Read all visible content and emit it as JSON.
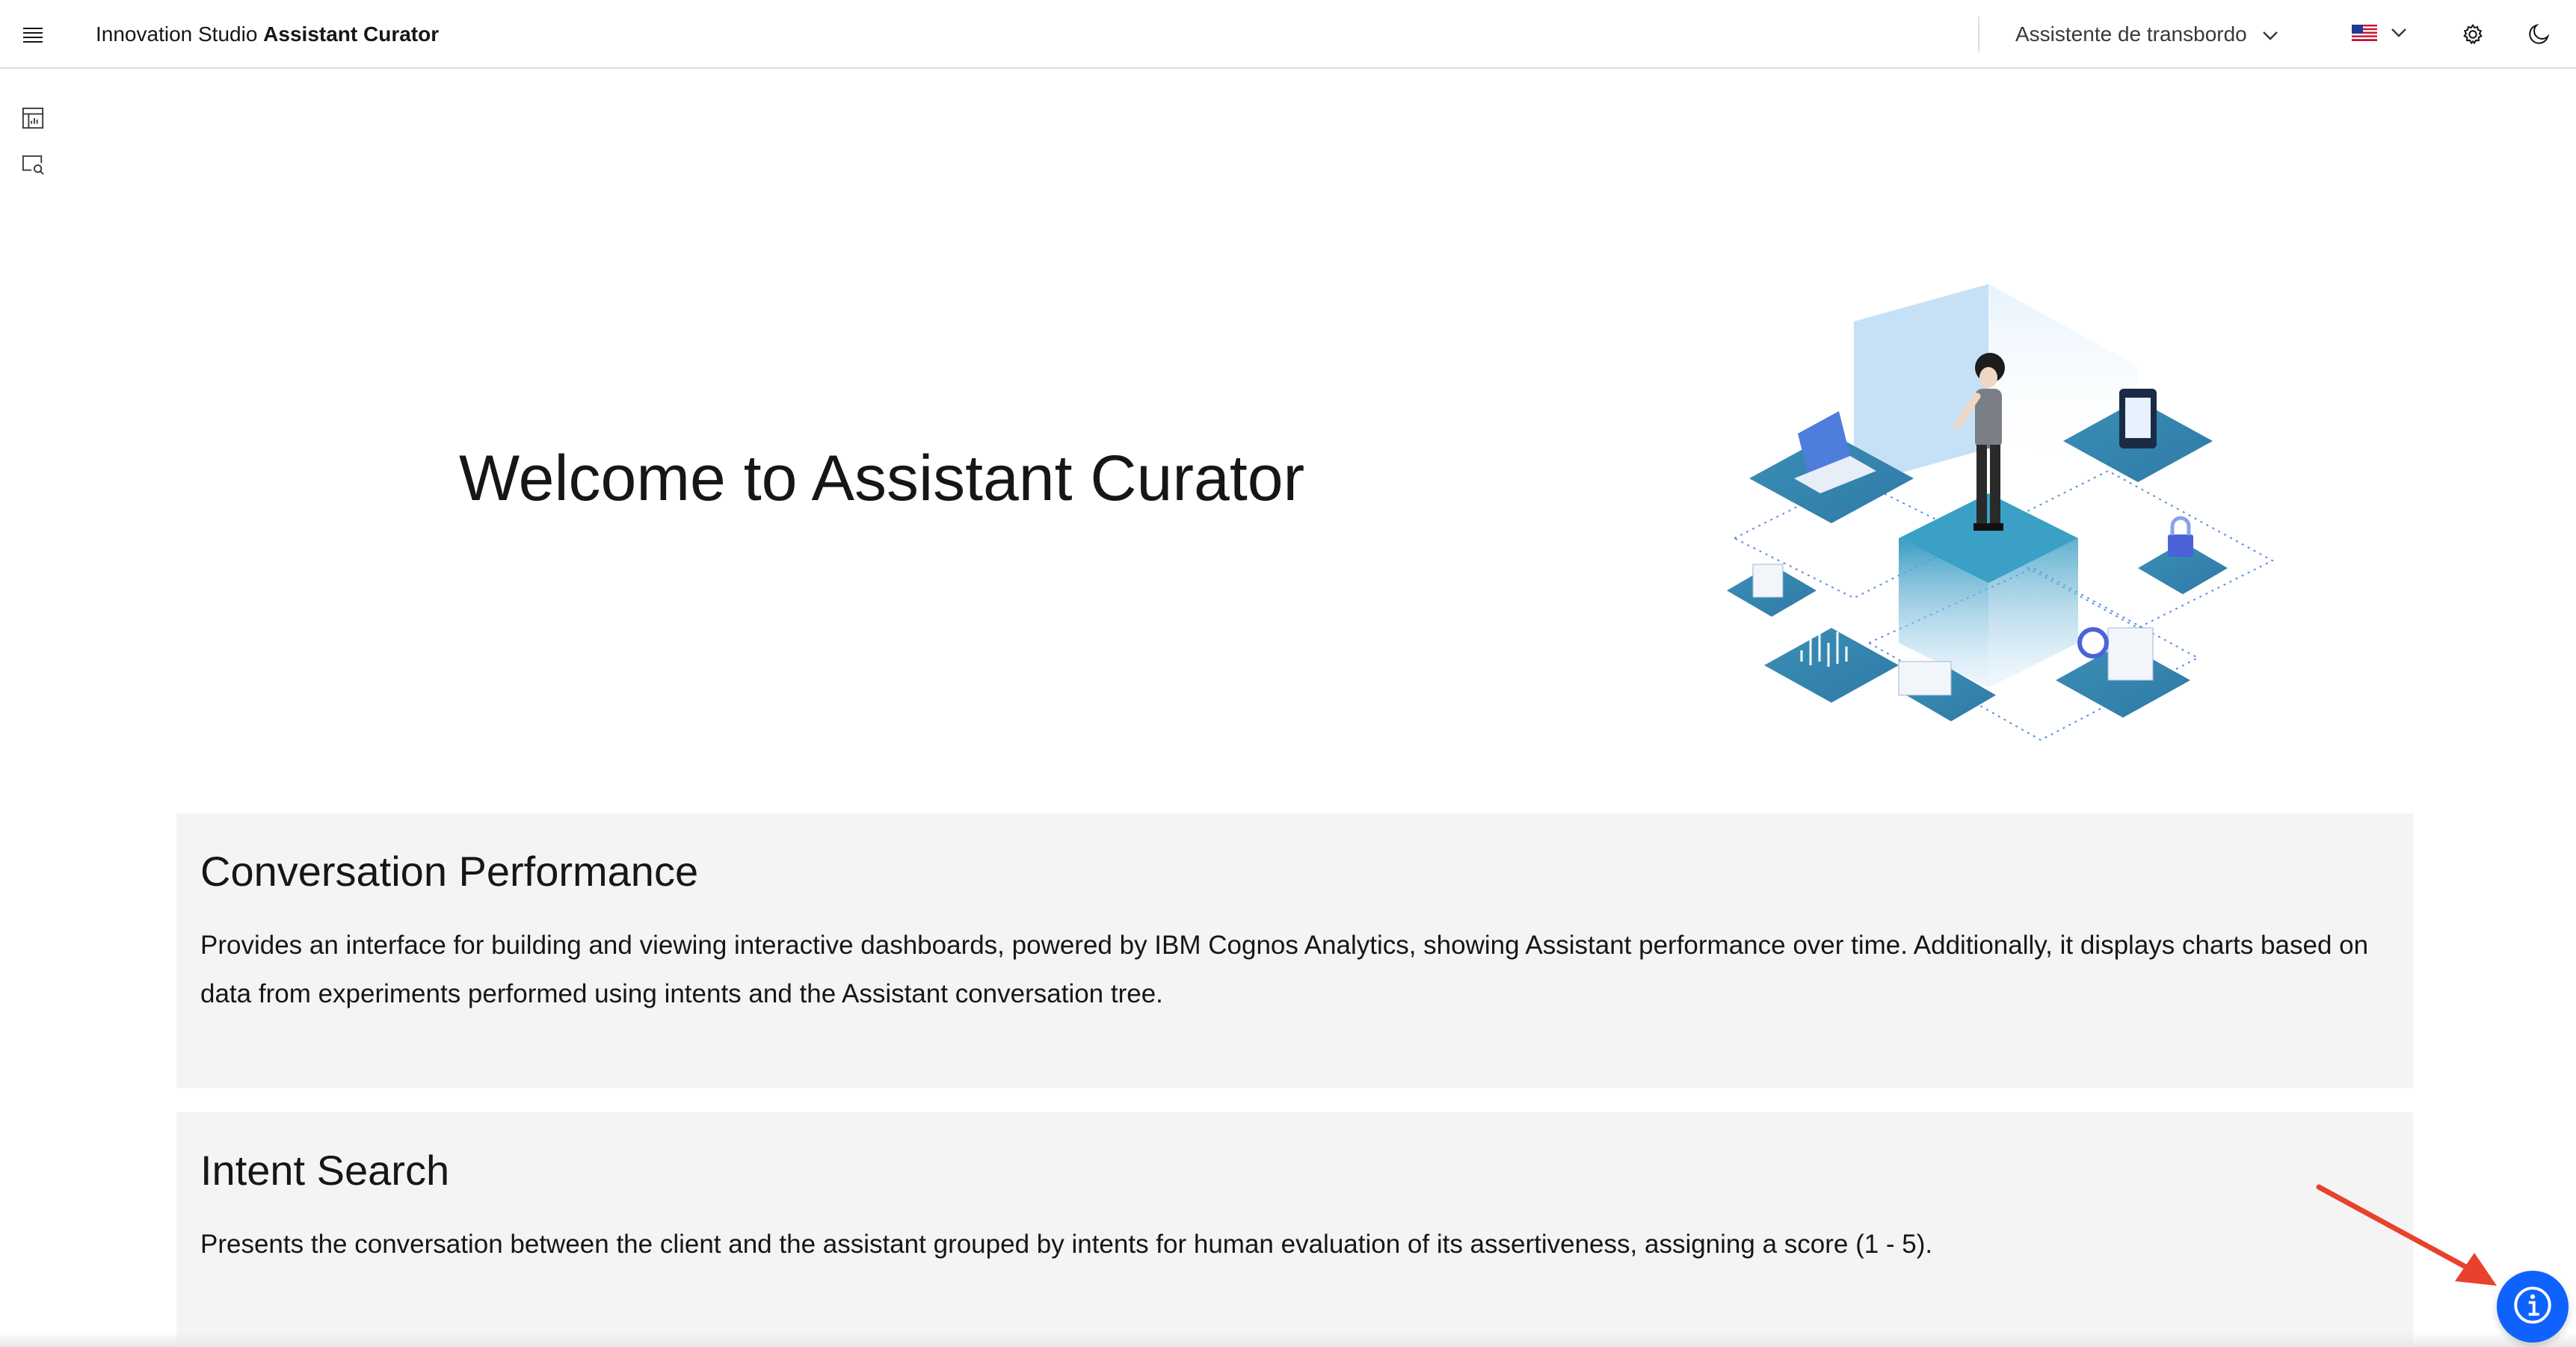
{
  "header": {
    "brand_prefix": "Innovation Studio",
    "brand_name": "Assistant Curator",
    "assistant_selector": "Assistente de transbordo",
    "language_flag_icon": "us-flag-icon"
  },
  "sidebar": {
    "items": [
      {
        "icon": "dashboard-icon"
      },
      {
        "icon": "search-icon"
      }
    ]
  },
  "hero": {
    "title": "Welcome to Assistant Curator"
  },
  "cards": [
    {
      "title": "Conversation Performance",
      "description": "Provides an interface for building and viewing interactive dashboards, powered by IBM Cognos Analytics, showing Assistant performance over time. Additionally, it displays charts based on data from experiments performed using intents and the Assistant conversation tree."
    },
    {
      "title": "Intent Search",
      "description": "Presents the conversation between the client and the assistant grouped by intents for human evaluation of its assertiveness, assigning a score (1 - 5)."
    }
  ],
  "colors": {
    "accent": "#0f62fe",
    "card_bg": "#f4f4f4",
    "annotation_arrow": "#e8412c",
    "tile": "#3a8fb7"
  }
}
